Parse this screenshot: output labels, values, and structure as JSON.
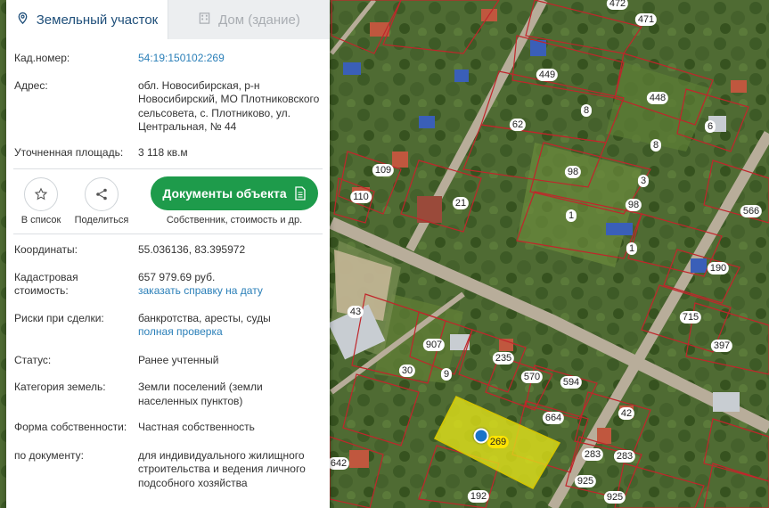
{
  "tabs": [
    {
      "label": "Земельный участок",
      "icon": "map-pin-icon"
    },
    {
      "label": "Дом (здание)",
      "icon": "building-icon"
    }
  ],
  "fields": {
    "cadastral_number": {
      "label": "Кад.номер:",
      "value": "54:19:150102:269"
    },
    "address": {
      "label": "Адрес:",
      "value": "обл. Новосибирская, р-н Новосибирский, МО Плотниковского сельсовета, с. Плотниково, ул. Центральная, № 44"
    },
    "area": {
      "label": "Уточненная площадь:",
      "value": "3 118 кв.м"
    }
  },
  "actions": {
    "add_to_list": "В список",
    "share": "Поделиться",
    "documents_button": "Документы объекта",
    "documents_sub": "Собственник, стоимость и др."
  },
  "details": {
    "coords": {
      "label": "Координаты:",
      "value": "55.036136, 83.395972"
    },
    "cad_value": {
      "label": "Кадастровая стоимость:",
      "value": "657 979.69 руб.",
      "link": "заказать справку на дату"
    },
    "risks": {
      "label": "Риски при сделки:",
      "value": "банкротства, аресты, суды",
      "link": "полная проверка"
    },
    "status": {
      "label": "Статус:",
      "value": "Ранее учтенный"
    },
    "land_category": {
      "label": "Категория земель:",
      "value": "Земли поселений (земли населенных пунктов)"
    },
    "ownership": {
      "label": "Форма собственности:",
      "value": "Частная собственность"
    },
    "by_document": {
      "label": "по документу:",
      "value": "для индивидуального жилищного строительства и ведения личного подсобного хозяйства"
    }
  },
  "map": {
    "highlighted_parcel": "269",
    "parcel_labels": [
      "472",
      "471",
      "449",
      "448",
      "62",
      "8",
      "6",
      "109",
      "98",
      "8",
      "110",
      "21",
      "3",
      "98",
      "566",
      "1",
      "1",
      "190",
      "715",
      "397",
      "43",
      "907",
      "235",
      "570",
      "594",
      "30",
      "9",
      "664",
      "42",
      "283",
      "283",
      "642",
      "192",
      "925",
      "925"
    ],
    "colors": {
      "parcel_border": "#c0262b",
      "highlight_fill": "#e4e41a",
      "accent_green": "#1e9b4b",
      "link_blue": "#2a7fb8"
    }
  }
}
